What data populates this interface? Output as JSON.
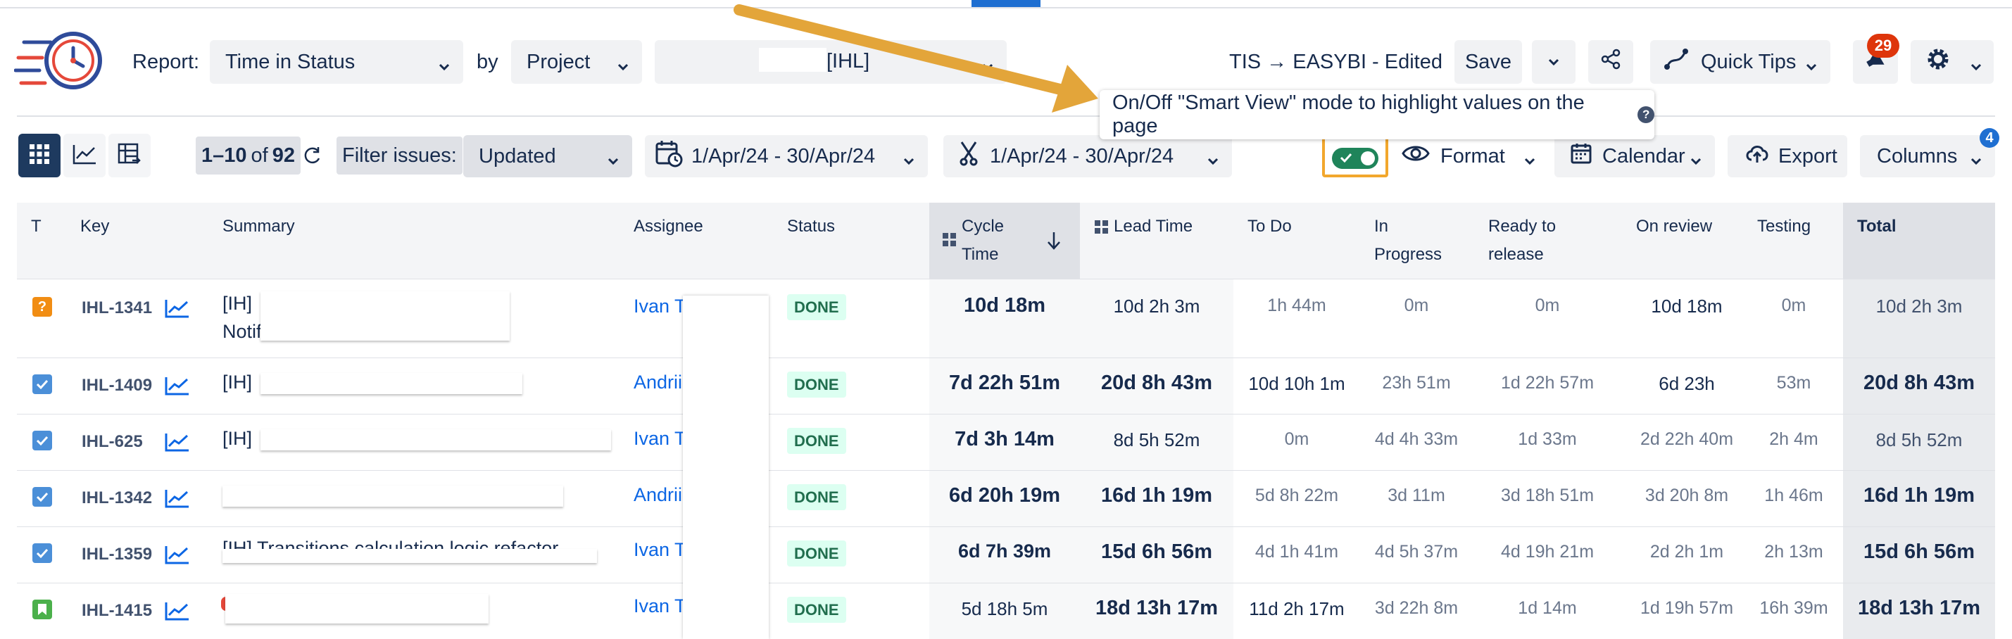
{
  "header": {
    "report_label": "Report:",
    "report_value": "Time in Status",
    "by_label": "by",
    "by_value": "Project",
    "project_value": "[IHL]",
    "title": "TIS → EASYBI - Edited",
    "save_label": "Save",
    "quick_tips_label": "Quick Tips",
    "notifications_count": "29"
  },
  "toolbar": {
    "range_start_end": "1–10",
    "range_of": "of",
    "range_total": "92",
    "filter_label": "Filter issues:",
    "filter_value": "Updated",
    "date_range": "1/Apr/24 - 30/Apr/24",
    "tool_date_range": "1/Apr/24 - 30/Apr/24",
    "format_label": "Format",
    "calendar_label": "Calendar",
    "export_label": "Export",
    "columns_label": "Columns",
    "columns_badge": "4"
  },
  "tooltip": {
    "text": "On/Off \"Smart View\" mode to highlight values on the page",
    "help": "?"
  },
  "colors": {
    "accent": "#1f6fd1",
    "done_bg": "#dcfff1",
    "done_text": "#216e4e",
    "highlight_border": "#f2a72d",
    "toggle_on": "#1f845a"
  },
  "table": {
    "headers": {
      "t": "T",
      "key": "Key",
      "summary": "Summary",
      "assignee": "Assignee",
      "status": "Status",
      "cycle_1": "Cycle",
      "cycle_2": "Time",
      "lead_time": "Lead Time",
      "todo": "To Do",
      "in_progress_1": "In",
      "in_progress_2": "Progress",
      "ready_1": "Ready to",
      "ready_2": "release",
      "on_review": "On review",
      "testing": "Testing",
      "total": "Total"
    },
    "rows": [
      {
        "type": "question-icon",
        "key": "IHL-1341",
        "summary_a": "[IH]",
        "summary_b": "Notification to IH",
        "assignee": "Ivan T",
        "status": "DONE",
        "cycle": "10d 18m",
        "lead": "10d 2h 3m",
        "todo": "1h 44m",
        "inprog": "0m",
        "ready": "0m",
        "review": "10d 18m",
        "testing": "0m",
        "total": "10d 2h 3m"
      },
      {
        "type": "task-icon",
        "key": "IHL-1409",
        "summary_a": "[IH]",
        "summary_b": "",
        "assignee": "Andrii",
        "status": "DONE",
        "cycle": "7d 22h 51m",
        "lead": "20d 8h 43m",
        "todo": "10d 10h 1m",
        "inprog": "23h 51m",
        "ready": "1d 22h 57m",
        "review": "6d 23h",
        "testing": "53m",
        "total": "20d 8h 43m"
      },
      {
        "type": "task-icon",
        "key": "IHL-625",
        "summary_a": "[IH]",
        "summary_b": "",
        "assignee": "Ivan T",
        "status": "DONE",
        "cycle": "7d 3h 14m",
        "lead": "8d 5h 52m",
        "todo": "0m",
        "inprog": "4d 4h 33m",
        "ready": "1d 33m",
        "review": "2d 22h 40m",
        "testing": "2h 4m",
        "total": "8d 5h 52m"
      },
      {
        "type": "task-icon",
        "key": "IHL-1342",
        "summary_a": "",
        "summary_b": "",
        "assignee": "Andrii",
        "status": "DONE",
        "cycle": "6d 20h 19m",
        "lead": "16d 1h 19m",
        "todo": "5d 8h 22m",
        "inprog": "3d 11m",
        "ready": "3d 18h 51m",
        "review": "3d 20h 8m",
        "testing": "1h 46m",
        "total": "16d 1h 19m"
      },
      {
        "type": "task-icon",
        "key": "IHL-1359",
        "summary_a": "[IH] Transitions calculation logic refactor",
        "summary_b": "",
        "assignee": "Ivan T",
        "status": "DONE",
        "cycle": "6d 7h 39m",
        "lead": "15d 6h 56m",
        "todo": "4d 1h 41m",
        "inprog": "4d 5h 37m",
        "ready": "4d 19h 21m",
        "review": "2d 2h 1m",
        "testing": "2h 13m",
        "total": "15d 6h 56m"
      },
      {
        "type": "story-icon",
        "key": "IHL-1415",
        "summary_a": "",
        "summary_b": "",
        "assignee": "Ivan T",
        "status": "DONE",
        "cycle": "5d 18h 5m",
        "lead": "18d 13h 17m",
        "todo": "11d 2h 17m",
        "inprog": "3d 22h 8m",
        "ready": "1d 14m",
        "review": "1d 19h 57m",
        "testing": "16h 39m",
        "total": "18d 13h 17m"
      }
    ]
  }
}
